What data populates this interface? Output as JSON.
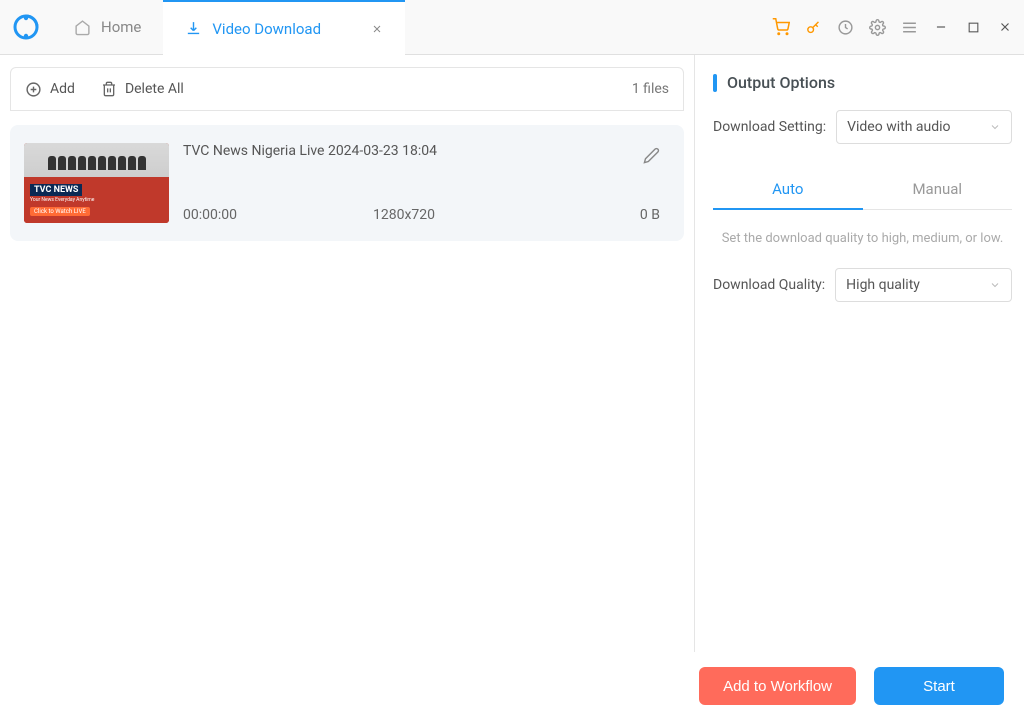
{
  "tabs": {
    "home": "Home",
    "active": "Video Download"
  },
  "toolbar": {
    "add": "Add",
    "deleteAll": "Delete All",
    "count": "1 files"
  },
  "item": {
    "title": "TVC News Nigeria Live 2024-03-23 18:04",
    "duration": "00:00:00",
    "resolution": "1280x720",
    "size": "0 B",
    "thumbLabel": "TVC NEWS"
  },
  "output": {
    "sectionTitle": "Output Options",
    "settingLabel": "Download Setting:",
    "settingValue": "Video with audio",
    "tabAuto": "Auto",
    "tabManual": "Manual",
    "hint": "Set the download quality to high, medium, or low.",
    "qualityLabel": "Download Quality:",
    "qualityValue": "High quality"
  },
  "footer": {
    "workflow": "Add to Workflow",
    "start": "Start"
  }
}
